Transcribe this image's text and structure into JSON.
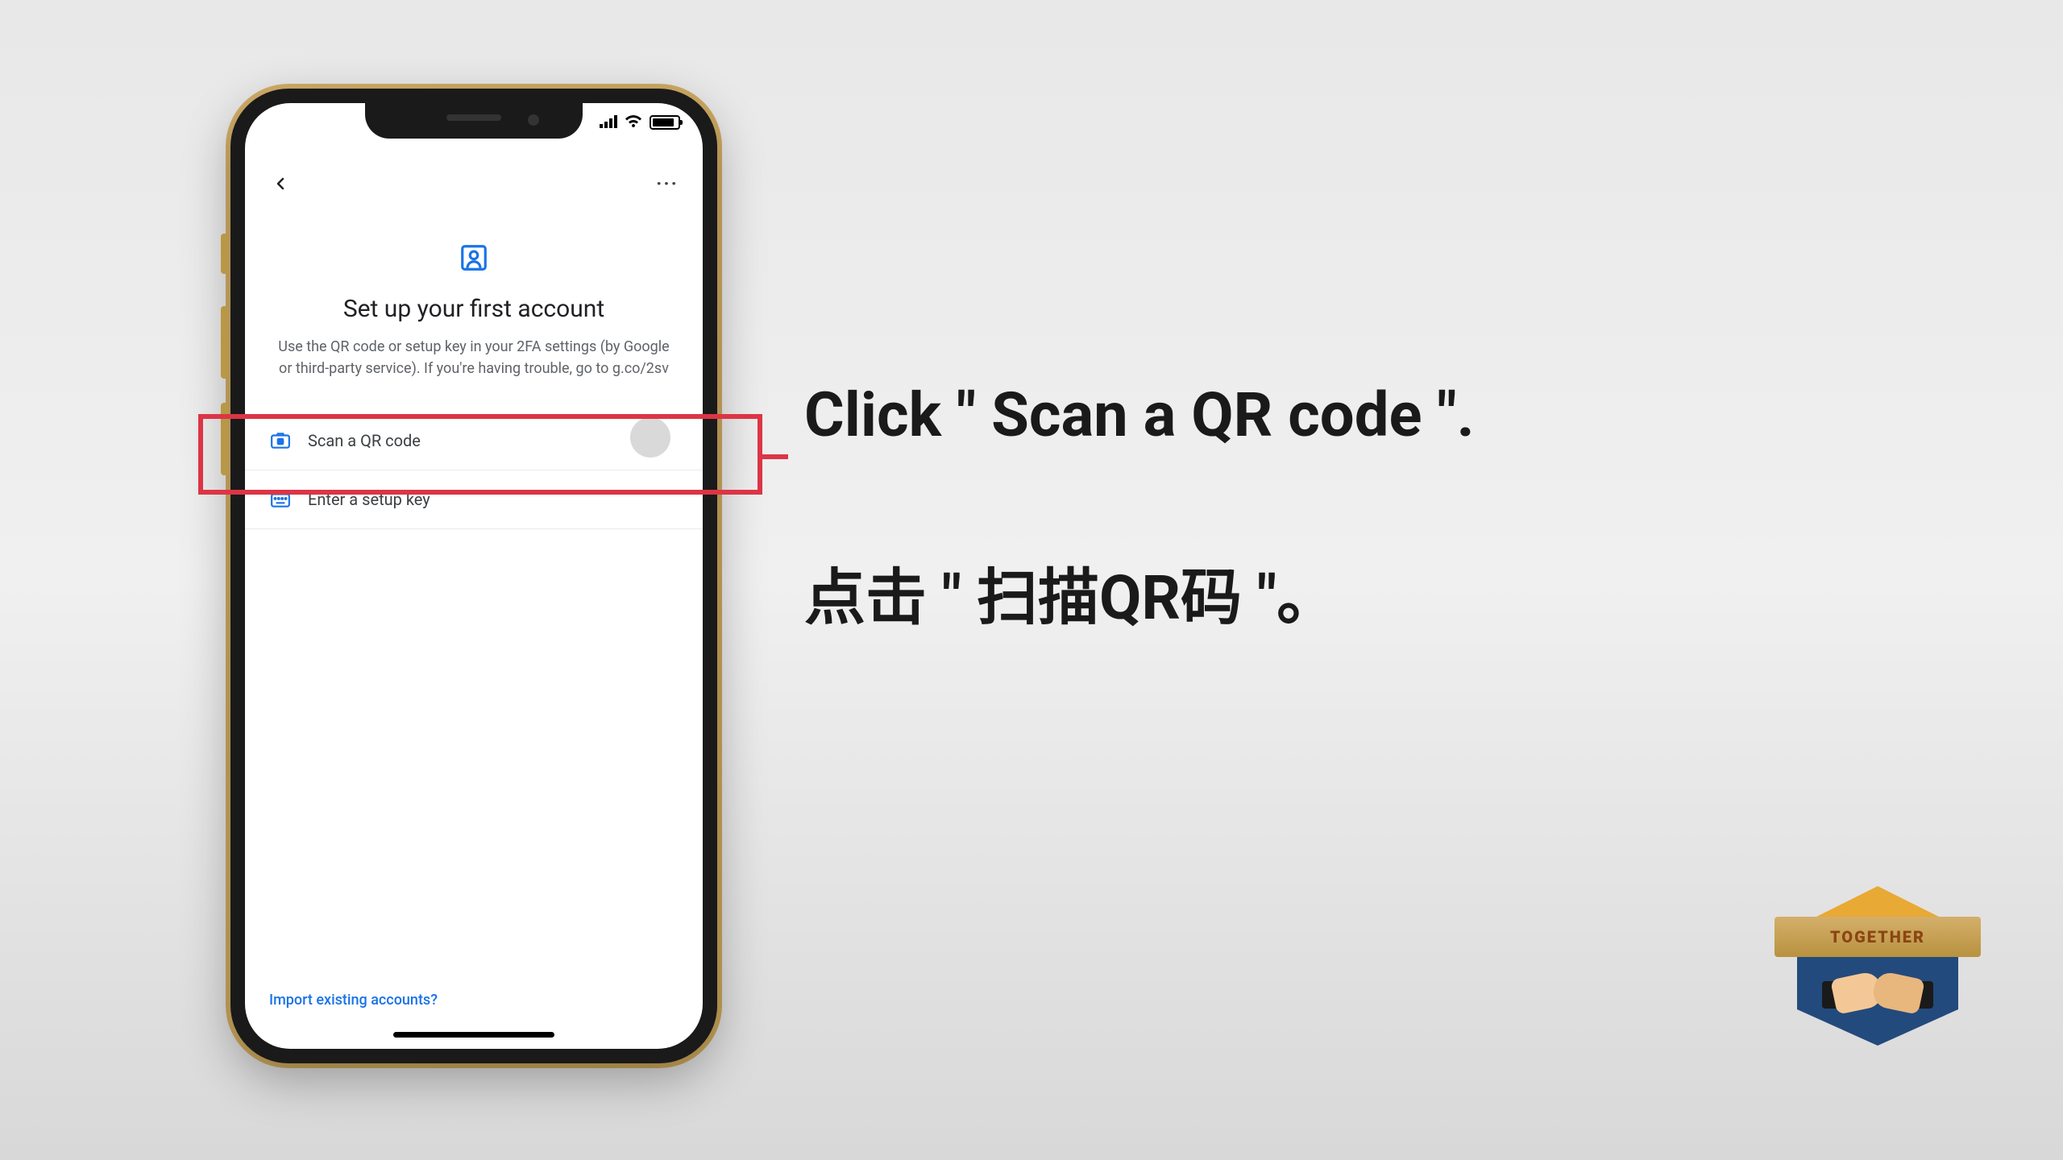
{
  "phone": {
    "app": {
      "title": "Set up your first account",
      "description": "Use the QR code or setup key in your 2FA settings (by Google or third-party service). If you're having trouble, go to g.co/2sv",
      "options": {
        "scan": "Scan a QR code",
        "key": "Enter a setup key"
      },
      "import_link": "Import existing accounts?"
    }
  },
  "instruction": {
    "en": "Click \" Scan a QR code \".",
    "zh": "点击 \" 扫描QR码 \"。"
  },
  "logo": {
    "banner": "TOGETHER"
  },
  "colors": {
    "highlight": "#dc3545",
    "google_blue": "#1a73e8"
  }
}
